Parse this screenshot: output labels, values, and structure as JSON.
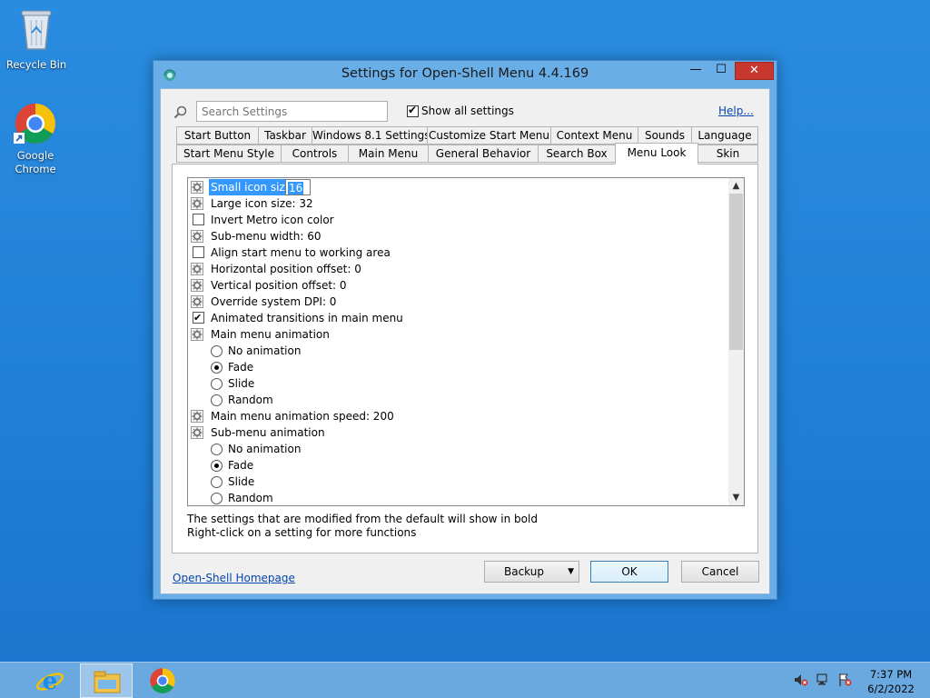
{
  "desktop": {
    "icons": [
      {
        "label": "Recycle Bin",
        "icon": "recycle-bin-icon"
      },
      {
        "label": "Google Chrome",
        "icon": "chrome-icon"
      }
    ]
  },
  "window": {
    "title": "Settings for Open-Shell Menu 4.4.169",
    "controls": {
      "minimize": "—",
      "maximize": "☐",
      "close": "✕"
    },
    "search_placeholder": "Search Settings",
    "show_all_label": "Show all settings",
    "show_all_checked": true,
    "help_label": "Help...",
    "tabs_row1": [
      "Start Button",
      "Taskbar",
      "Windows 8.1 Settings",
      "Customize Start Menu",
      "Context Menu",
      "Sounds",
      "Language"
    ],
    "tabs_row2": [
      "Start Menu Style",
      "Controls",
      "Main Menu",
      "General Behavior",
      "Search Box",
      "Menu Look",
      "Skin"
    ],
    "active_tab": "Menu Look",
    "settings": [
      {
        "type": "gear",
        "label": "Small icon size",
        "edit_value": "16",
        "selected": true
      },
      {
        "type": "gear",
        "label": "Large icon size: 32"
      },
      {
        "type": "check",
        "label": "Invert Metro icon color",
        "checked": false
      },
      {
        "type": "gear",
        "label": "Sub-menu width: 60"
      },
      {
        "type": "check",
        "label": "Align start menu to working area",
        "checked": false
      },
      {
        "type": "gear",
        "label": "Horizontal position offset: 0"
      },
      {
        "type": "gear",
        "label": "Vertical position offset: 0"
      },
      {
        "type": "gear",
        "label": "Override system DPI: 0"
      },
      {
        "type": "check",
        "label": "Animated transitions in main menu",
        "checked": true
      },
      {
        "type": "gear",
        "label": "Main menu animation"
      },
      {
        "type": "radio",
        "label": "No animation",
        "checked": false
      },
      {
        "type": "radio",
        "label": "Fade",
        "checked": true
      },
      {
        "type": "radio",
        "label": "Slide",
        "checked": false
      },
      {
        "type": "radio",
        "label": "Random",
        "checked": false
      },
      {
        "type": "gear",
        "label": "Main menu animation speed: 200"
      },
      {
        "type": "gear",
        "label": "Sub-menu animation"
      },
      {
        "type": "radio",
        "label": "No animation",
        "checked": false
      },
      {
        "type": "radio",
        "label": "Fade",
        "checked": true
      },
      {
        "type": "radio",
        "label": "Slide",
        "checked": false
      },
      {
        "type": "radio",
        "label": "Random",
        "checked": false
      }
    ],
    "hint_line1": "The settings that are modified from the default will show in bold",
    "hint_line2": "Right-click on a setting for more functions",
    "homepage_link": "Open-Shell Homepage",
    "backup_label": "Backup",
    "ok_label": "OK",
    "cancel_label": "Cancel"
  },
  "taskbar": {
    "pinned": [
      {
        "name": "Internet Explorer",
        "icon": "ie-icon"
      },
      {
        "name": "File Explorer",
        "icon": "file-explorer-icon",
        "active": true
      },
      {
        "name": "Google Chrome",
        "icon": "chrome-icon"
      }
    ],
    "tray_icons": [
      "speaker-muted-icon",
      "network-icon",
      "action-center-flag-icon"
    ],
    "time": "7:37 PM",
    "date": "6/2/2022"
  },
  "colors": {
    "desktop": "#1f7fd7",
    "close_button": "#c7372e",
    "selection": "#3399ff",
    "link": "#0645ad"
  }
}
